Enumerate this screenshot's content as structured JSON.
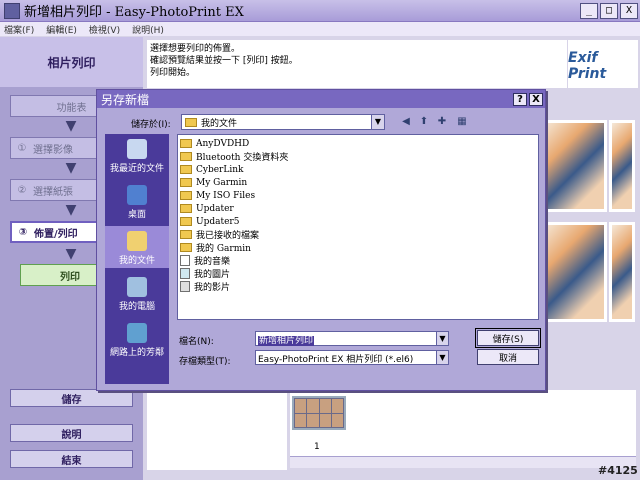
{
  "window": {
    "title": "新增相片列印 - Easy-PhotoPrint EX",
    "min": "_",
    "max": "□",
    "close": "X"
  },
  "menu": [
    "檔案(F)",
    "編輯(E)",
    "檢視(V)",
    "說明(H)"
  ],
  "leftpanel": {
    "header": "相片列印",
    "menu_btn": "功能表",
    "steps": [
      {
        "num": "①",
        "label": "選擇影像"
      },
      {
        "num": "②",
        "label": "選擇紙張"
      },
      {
        "num": "③",
        "label": "佈置/列印"
      }
    ],
    "print_btn": "列印",
    "save_btn": "儲存",
    "help_btn": "說明",
    "exit_btn": "結束"
  },
  "instructions": [
    "選擇想要列印的佈置。",
    "確認預覽結果並按一下 [列印] 按鈕。",
    "列印開始。"
  ],
  "exif_logo": "Exif Print",
  "thumbnail": {
    "number": "1"
  },
  "watermark": "#4125",
  "dialog": {
    "title": "另存新檔",
    "help": "?",
    "close": "X",
    "save_in_label": "儲存於(I):",
    "save_in_value": "我的文件",
    "places": [
      "我最近的文件",
      "桌面",
      "我的文件",
      "我的電腦",
      "網路上的芳鄰"
    ],
    "files": [
      {
        "name": "AnyDVDHD",
        "icon": "folder-icon"
      },
      {
        "name": "Bluetooth 交換資料夾",
        "icon": "folder-icon"
      },
      {
        "name": "CyberLink",
        "icon": "folder-icon"
      },
      {
        "name": "My Garmin",
        "icon": "folder-icon"
      },
      {
        "name": "My ISO Files",
        "icon": "folder-icon"
      },
      {
        "name": "Updater",
        "icon": "folder-icon"
      },
      {
        "name": "Updater5",
        "icon": "folder-icon"
      },
      {
        "name": "我已接收的檔案",
        "icon": "folder-icon"
      },
      {
        "name": "我的 Garmin",
        "icon": "folder-icon"
      },
      {
        "name": "我的音樂",
        "icon": "music-folder-icon"
      },
      {
        "name": "我的圖片",
        "icon": "pictures-folder-icon"
      },
      {
        "name": "我的影片",
        "icon": "video-folder-icon"
      }
    ],
    "filename_label": "檔名(N):",
    "filename_value": "新增相片列印",
    "filetype_label": "存檔類型(T):",
    "filetype_value": "Easy-PhotoPrint EX 相片列印 (*.el6)",
    "save_btn": "儲存(S)",
    "cancel_btn": "取消"
  }
}
